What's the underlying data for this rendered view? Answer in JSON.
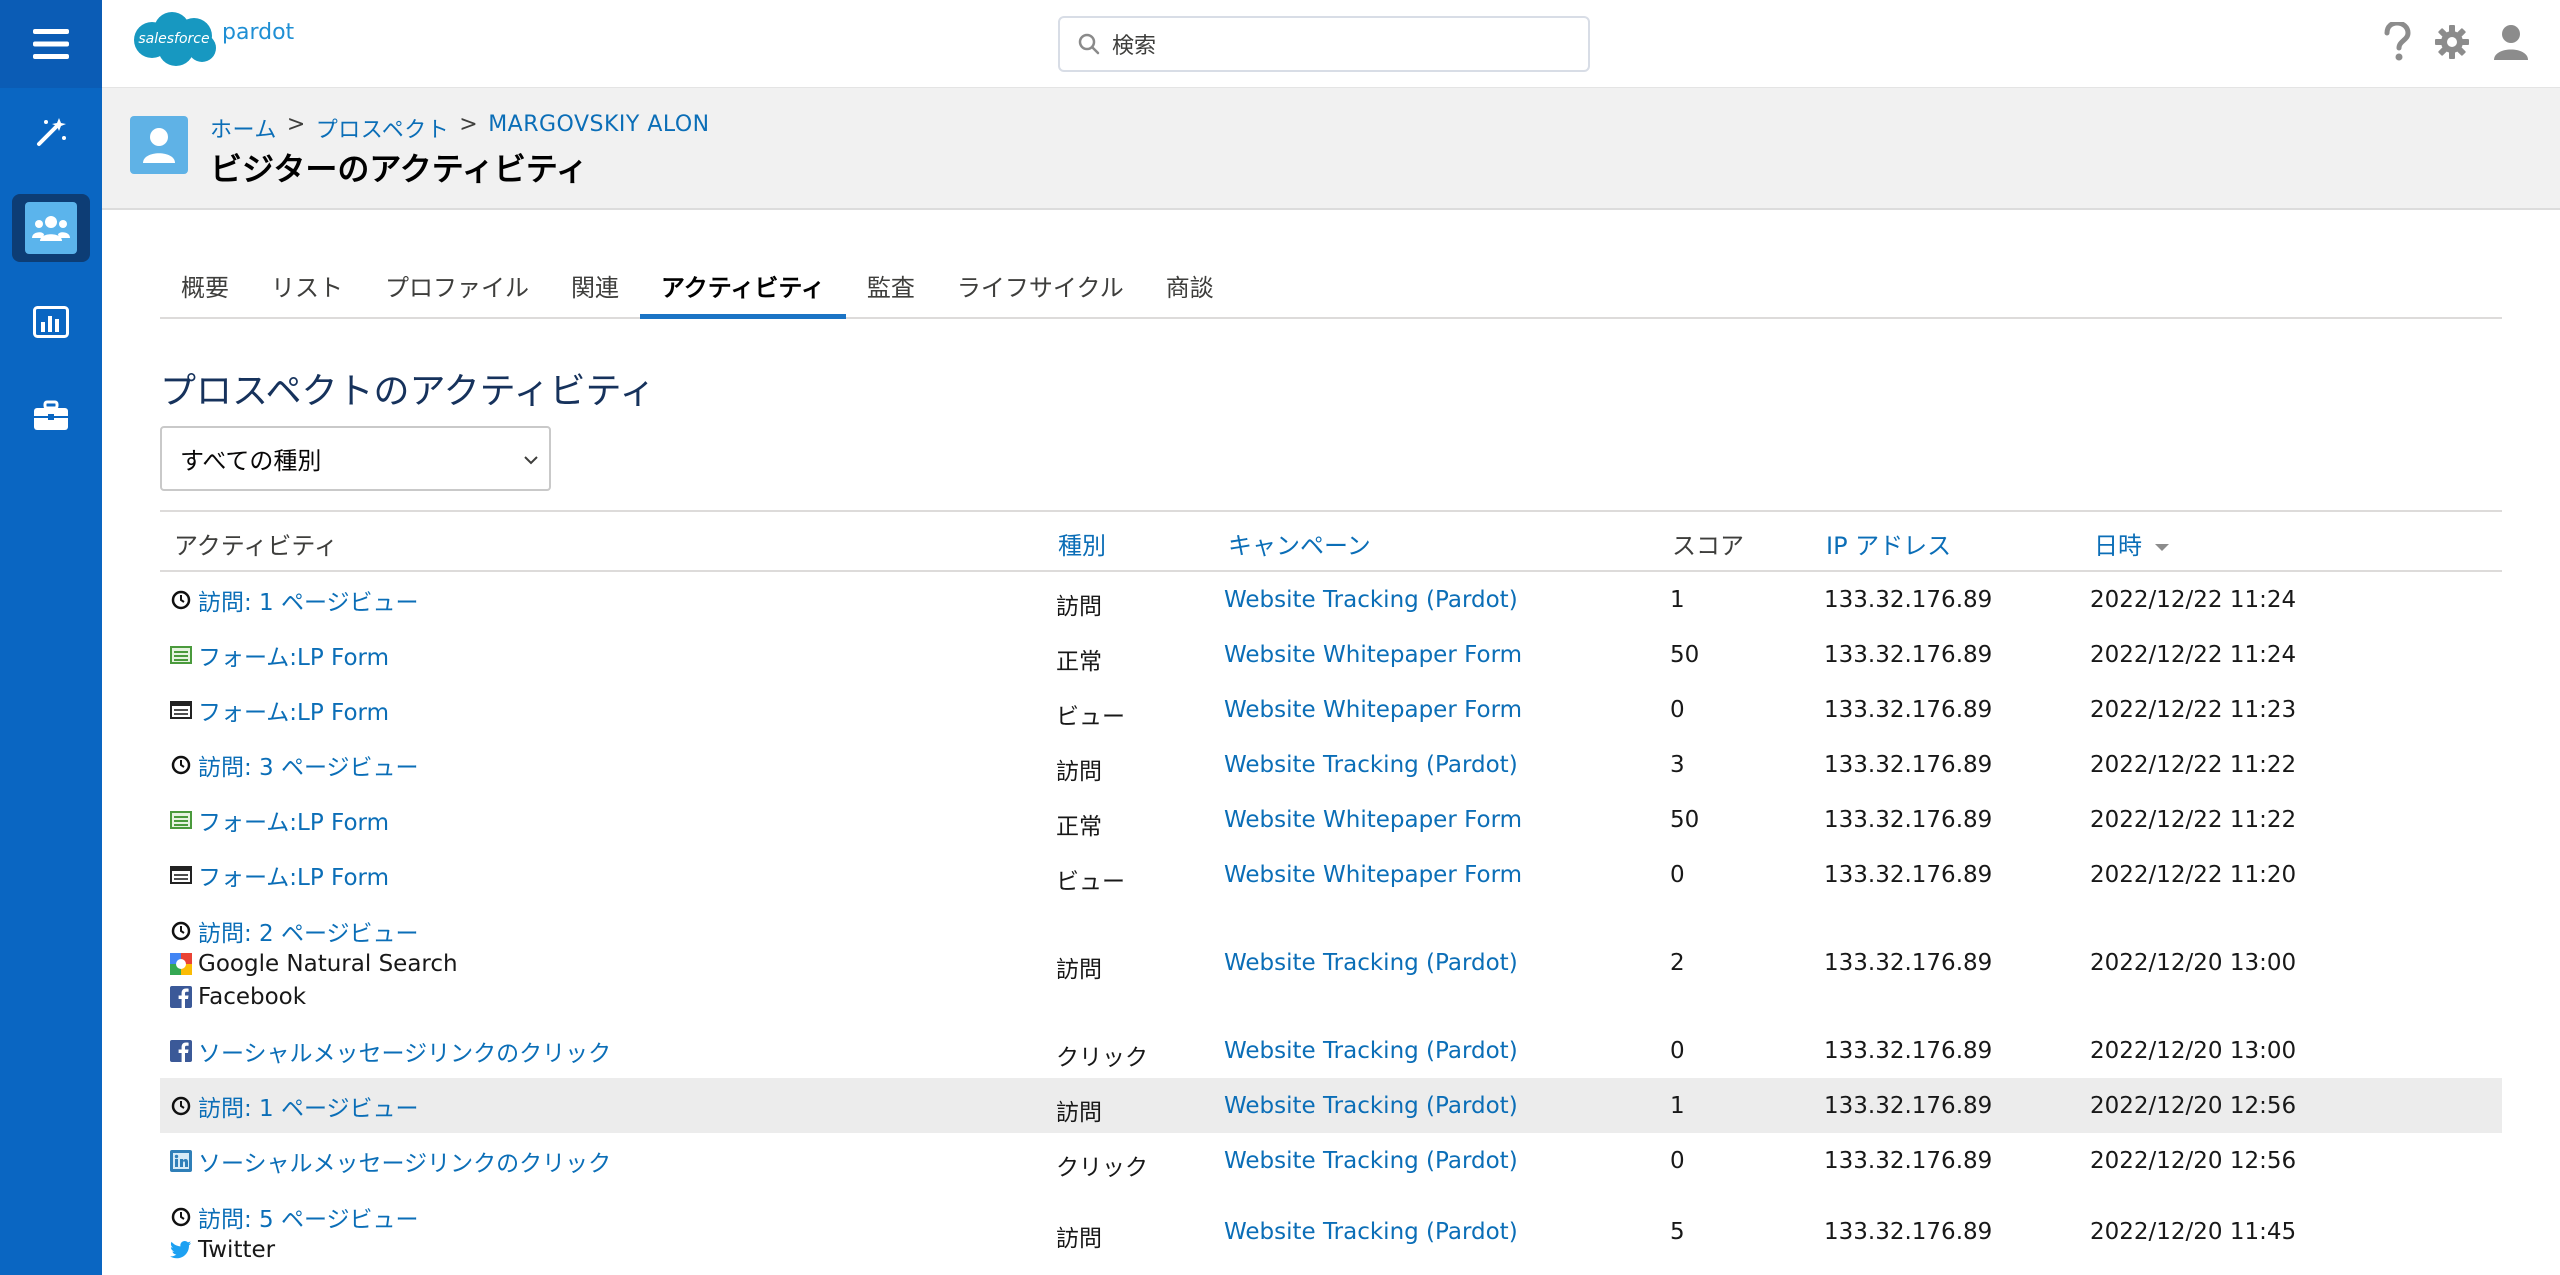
{
  "app": {
    "brand_word": "salesforce",
    "product": "pardot",
    "search_placeholder": "検索"
  },
  "breadcrumb": {
    "home": "ホーム",
    "sep": ">",
    "prospects": "プロスペクト",
    "record": "MARGOVSKIY ALON"
  },
  "page_title": "ビジターのアクティビティ",
  "tabs": [
    {
      "label": "概要"
    },
    {
      "label": "リスト"
    },
    {
      "label": "プロファイル"
    },
    {
      "label": "関連"
    },
    {
      "label": "アクティビティ",
      "active": true
    },
    {
      "label": "監査"
    },
    {
      "label": "ライフサイクル"
    },
    {
      "label": "商談"
    }
  ],
  "section_title": "プロスペクトのアクティビティ",
  "filter": {
    "selected": "すべての種別"
  },
  "table": {
    "headers": {
      "activity": "アクティビティ",
      "type": "種別",
      "campaign": "キャンペーン",
      "score": "スコア",
      "ip": "IP アドレス",
      "date": "日時"
    },
    "rows": [
      {
        "lines": [
          {
            "icon": "clock-icon",
            "text": "訪問: 1 ページビュー",
            "link": true
          }
        ],
        "type": "訪問",
        "campaign": "Website Tracking (Pardot)",
        "score": "1",
        "ip": "133.32.176.89",
        "date": "2022/12/22 11:24"
      },
      {
        "lines": [
          {
            "icon": "form-green-icon",
            "text": "フォーム:LP Form",
            "link": true
          }
        ],
        "type": "正常",
        "campaign": "Website Whitepaper Form",
        "score": "50",
        "ip": "133.32.176.89",
        "date": "2022/12/22 11:24"
      },
      {
        "lines": [
          {
            "icon": "form-black-icon",
            "text": "フォーム:LP Form",
            "link": true
          }
        ],
        "type": "ビュー",
        "campaign": "Website Whitepaper Form",
        "score": "0",
        "ip": "133.32.176.89",
        "date": "2022/12/22 11:23"
      },
      {
        "lines": [
          {
            "icon": "clock-icon",
            "text": "訪問: 3 ページビュー",
            "link": true
          }
        ],
        "type": "訪問",
        "campaign": "Website Tracking (Pardot)",
        "score": "3",
        "ip": "133.32.176.89",
        "date": "2022/12/22 11:22"
      },
      {
        "lines": [
          {
            "icon": "form-green-icon",
            "text": "フォーム:LP Form",
            "link": true
          }
        ],
        "type": "正常",
        "campaign": "Website Whitepaper Form",
        "score": "50",
        "ip": "133.32.176.89",
        "date": "2022/12/22 11:22"
      },
      {
        "lines": [
          {
            "icon": "form-black-icon",
            "text": "フォーム:LP Form",
            "link": true
          }
        ],
        "type": "ビュー",
        "campaign": "Website Whitepaper Form",
        "score": "0",
        "ip": "133.32.176.89",
        "date": "2022/12/22 11:20"
      },
      {
        "lines": [
          {
            "icon": "clock-icon",
            "text": "訪問: 2 ページビュー",
            "link": true
          },
          {
            "icon": "google-icon",
            "text": "Google Natural Search",
            "link": false
          },
          {
            "icon": "facebook-icon",
            "text": "Facebook",
            "link": false
          }
        ],
        "type": "訪問",
        "campaign": "Website Tracking (Pardot)",
        "score": "2",
        "ip": "133.32.176.89",
        "date": "2022/12/20 13:00"
      },
      {
        "lines": [
          {
            "icon": "facebook-icon",
            "text": "ソーシャルメッセージリンクのクリック",
            "link": true
          }
        ],
        "type": "クリック",
        "campaign": "Website Tracking (Pardot)",
        "score": "0",
        "ip": "133.32.176.89",
        "date": "2022/12/20 13:00"
      },
      {
        "lines": [
          {
            "icon": "clock-icon",
            "text": "訪問: 1 ページビュー",
            "link": true
          }
        ],
        "type": "訪問",
        "campaign": "Website Tracking (Pardot)",
        "score": "1",
        "ip": "133.32.176.89",
        "date": "2022/12/20 12:56",
        "highlight": true
      },
      {
        "lines": [
          {
            "icon": "linkedin-icon",
            "text": "ソーシャルメッセージリンクのクリック",
            "link": true
          }
        ],
        "type": "クリック",
        "campaign": "Website Tracking (Pardot)",
        "score": "0",
        "ip": "133.32.176.89",
        "date": "2022/12/20 12:56"
      },
      {
        "lines": [
          {
            "icon": "clock-icon",
            "text": "訪問: 5 ページビュー",
            "link": true
          },
          {
            "icon": "twitter-icon",
            "text": "Twitter",
            "link": false
          }
        ],
        "type": "訪問",
        "campaign": "Website Tracking (Pardot)",
        "score": "5",
        "ip": "133.32.176.89",
        "date": "2022/12/20 11:45"
      }
    ]
  }
}
